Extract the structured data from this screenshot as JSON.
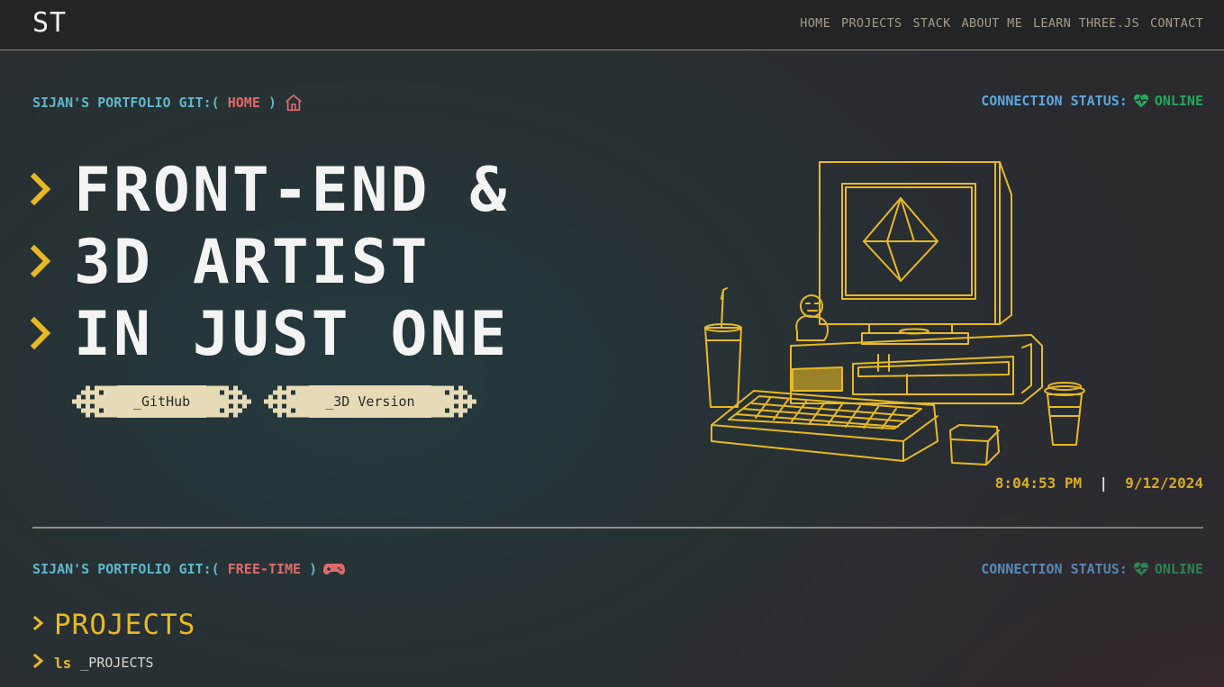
{
  "header": {
    "logo": "ST",
    "nav": [
      "HOME",
      "PROJECTS",
      "STACK",
      "ABOUT ME",
      "LEARN THREE.JS",
      "CONTACT"
    ]
  },
  "hero": {
    "git_prefix": "SIJAN'S PORTFOLIO GIT:(",
    "branch": "HOME",
    "git_suffix": ")",
    "branch_icon": "home-icon",
    "status_label": "CONNECTION STATUS:",
    "status_value": "ONLINE",
    "status_icon": "heartbeat-icon",
    "headline": [
      "FRONT-END &",
      "3D ARTIST",
      "IN JUST ONE"
    ],
    "buttons": [
      "_GitHub",
      "_3D Version"
    ],
    "time": "8:04:53 PM",
    "time_sep": "|",
    "date": "9/12/2024"
  },
  "section2": {
    "git_prefix": "SIJAN'S PORTFOLIO GIT:(",
    "branch": "FREE-TIME",
    "git_suffix": ")",
    "branch_icon": "gamepad-icon",
    "status_label": "CONNECTION STATUS:",
    "status_value": "ONLINE",
    "title": "PROJECTS",
    "cmd_keyword": "ls",
    "cmd_arg": "_PROJECTS"
  },
  "colors": {
    "accent_yellow": "#e8b923",
    "git_cyan": "#5fb7c9",
    "branch_red": "#e06a6a",
    "status_blue": "#5ea6dc",
    "online_green": "#26a65b",
    "button_cream": "#e6dbb6"
  }
}
